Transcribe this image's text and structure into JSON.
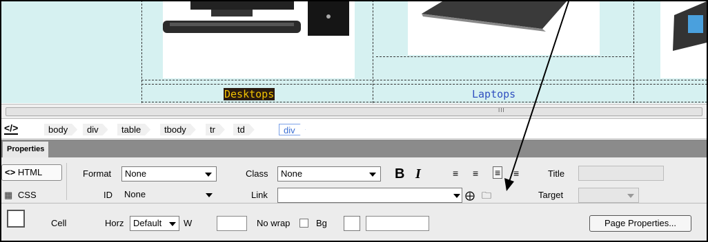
{
  "design": {
    "labels": {
      "desktops": "Desktops",
      "laptops": "Laptops"
    },
    "colors": {
      "cell_bg": "#d6f1f1",
      "desktops_text": "#f2c200",
      "desktops_bg": "#2a1a10",
      "laptops_text": "#3050c0"
    }
  },
  "scrollbar": {
    "grip": "III"
  },
  "tagbar": {
    "code_icon": "</>",
    "crumbs": [
      "body",
      "div",
      "table",
      "tbody",
      "tr",
      "td",
      "div"
    ]
  },
  "properties": {
    "tab_label": "Properties",
    "html_button": "HTML",
    "css_button": "CSS",
    "format_label": "Format",
    "format_value": "None",
    "id_label": "ID",
    "id_value": "None",
    "class_label": "Class",
    "class_value": "None",
    "bold_label": "B",
    "italic_label": "I",
    "link_label": "Link",
    "link_value": "",
    "title_label": "Title",
    "title_value": "",
    "target_label": "Target",
    "target_value": "",
    "cell_label": "Cell",
    "horz_label": "Horz",
    "horz_value": "Default",
    "w_label": "W",
    "w_value": "",
    "nowrap_label": "No wrap",
    "bg_label": "Bg",
    "bg_value": "",
    "page_properties_button": "Page Properties..."
  }
}
